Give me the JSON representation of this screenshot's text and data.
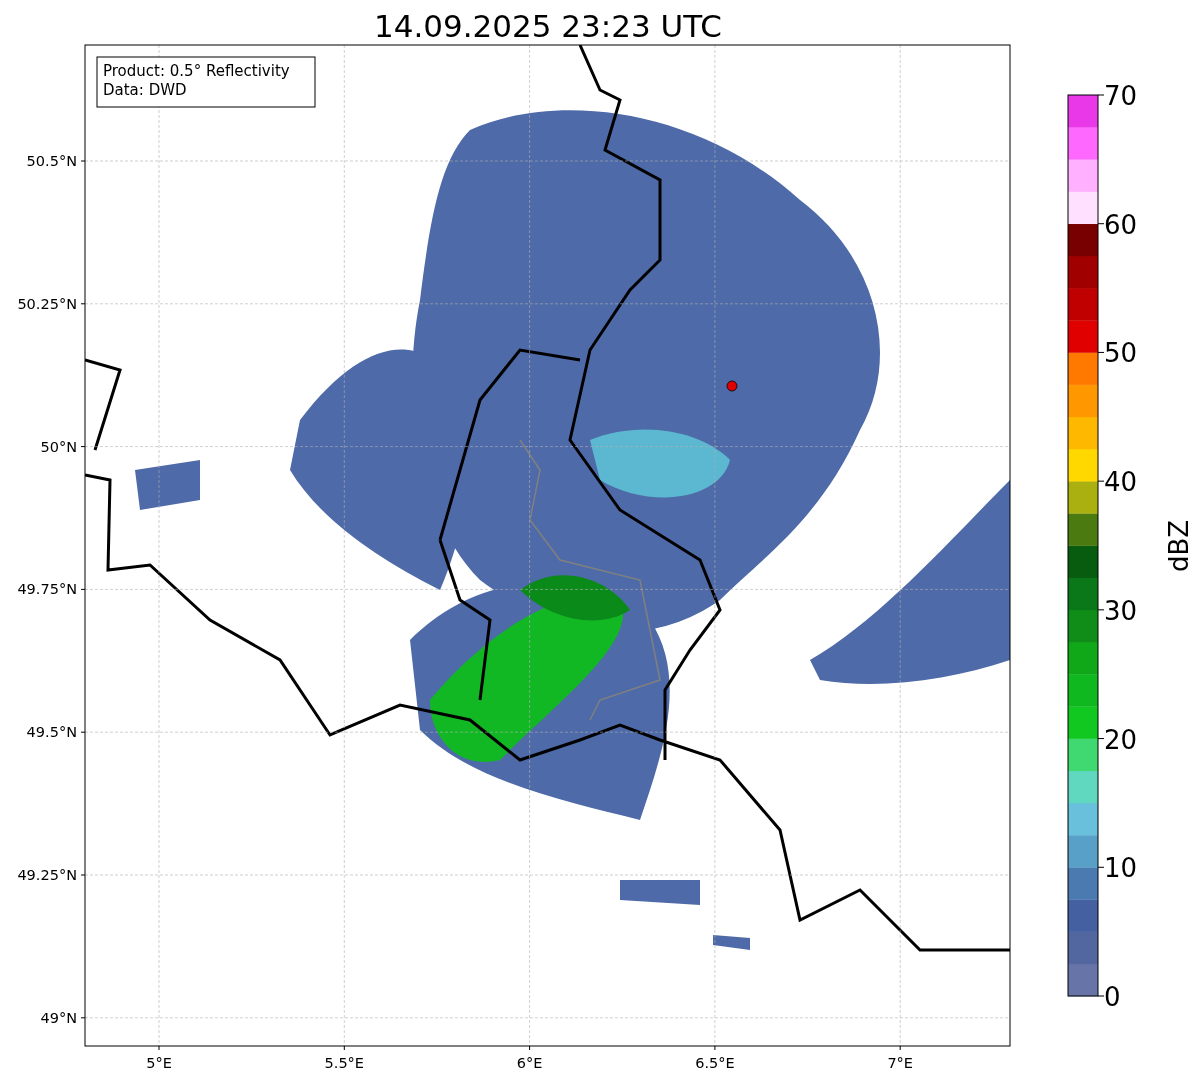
{
  "title": "14.09.2025 23:23 UTC",
  "map": {
    "legend": [
      "Product: 0.5° Reflectivity",
      "Data: DWD"
    ],
    "lat_ticks": [
      "50.5°N",
      "50.25°N",
      "50°N",
      "49.75°N",
      "49.5°N",
      "49.25°N",
      "49°N"
    ],
    "lon_ticks": [
      "5°E",
      "5.5°E",
      "6°E",
      "6.5°E",
      "7°E"
    ]
  },
  "colorbar": {
    "label": "dBZ",
    "ticks": [
      "70",
      "60",
      "50",
      "40",
      "30",
      "20",
      "10",
      "0"
    ],
    "segments": [
      {
        "color": "#6674a8"
      },
      {
        "color": "#5266a0"
      },
      {
        "color": "#4560a0"
      },
      {
        "color": "#4a7ab0"
      },
      {
        "color": "#58a0c8"
      },
      {
        "color": "#68c0dc"
      },
      {
        "color": "#60d8c0"
      },
      {
        "color": "#40d870"
      },
      {
        "color": "#10c820"
      },
      {
        "color": "#10b820"
      },
      {
        "color": "#10a818"
      },
      {
        "color": "#108c18"
      },
      {
        "color": "#0a7818"
      },
      {
        "color": "#085c10"
      },
      {
        "color": "#4a7a10"
      },
      {
        "color": "#aab010"
      },
      {
        "color": "#ffd800"
      },
      {
        "color": "#ffb800"
      },
      {
        "color": "#ff9800"
      },
      {
        "color": "#ff7800"
      },
      {
        "color": "#e00000"
      },
      {
        "color": "#c00000"
      },
      {
        "color": "#a00000"
      },
      {
        "color": "#780000"
      },
      {
        "color": "#ffe0ff"
      },
      {
        "color": "#ffb0ff"
      },
      {
        "color": "#ff68ff"
      },
      {
        "color": "#e838e8"
      }
    ]
  }
}
